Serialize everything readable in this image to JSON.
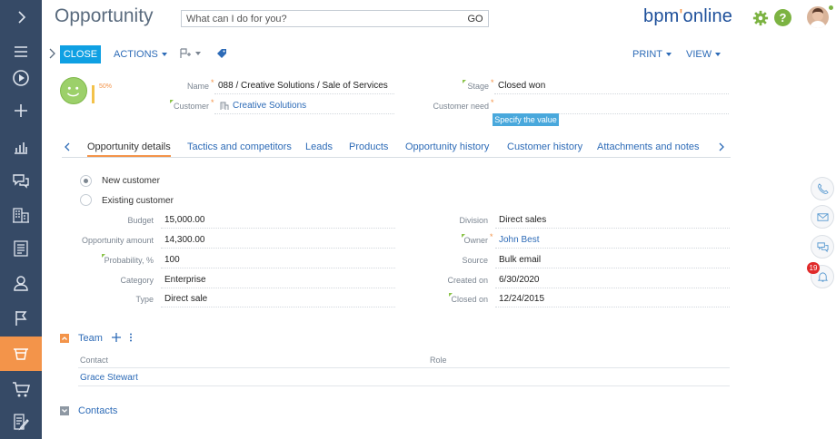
{
  "sidebar": {
    "items": [
      {
        "name": "expand",
        "icon": "chevron-right-icon"
      },
      {
        "name": "menu",
        "icon": "hamburger-icon"
      },
      {
        "name": "play",
        "icon": "play-circle-icon"
      },
      {
        "name": "add",
        "icon": "plus-icon"
      },
      {
        "name": "dashboards",
        "icon": "bar-chart-icon"
      },
      {
        "name": "feed",
        "icon": "chat-bubbles-icon"
      },
      {
        "name": "accounts",
        "icon": "buildings-icon"
      },
      {
        "name": "documents",
        "icon": "document-icon"
      },
      {
        "name": "contacts",
        "icon": "person-icon"
      },
      {
        "name": "flags",
        "icon": "flag-icon"
      },
      {
        "name": "opportunities",
        "icon": "funnel-icon",
        "active": true
      },
      {
        "name": "orders",
        "icon": "cart-icon"
      },
      {
        "name": "notes",
        "icon": "edit-icon"
      }
    ]
  },
  "header": {
    "title": "Opportunity",
    "search_placeholder": "What can I do for you?",
    "go_label": "GO",
    "logo_main": "bpm",
    "logo_tail": "online"
  },
  "toolbar": {
    "close_label": "CLOSE",
    "actions_label": "ACTIONS",
    "print_label": "PRINT",
    "view_label": "VIEW"
  },
  "summary": {
    "probability_text": "50%",
    "fields": {
      "name_label": "Name",
      "name_value": "088 / Creative Solutions / Sale of Services",
      "customer_label": "Customer",
      "customer_value": "Creative Solutions",
      "stage_label": "Stage",
      "stage_value": "Closed won",
      "customer_need_label": "Customer need",
      "specify_label": "Specify the value"
    }
  },
  "tabs": [
    {
      "label": "Opportunity details",
      "active": true
    },
    {
      "label": "Tactics and competitors"
    },
    {
      "label": "Leads"
    },
    {
      "label": "Products"
    },
    {
      "label": "Opportunity history"
    },
    {
      "label": "Customer history"
    },
    {
      "label": "Attachments and notes"
    }
  ],
  "details": {
    "radio_new": "New customer",
    "radio_existing": "Existing customer",
    "left": [
      {
        "label": "Budget",
        "value": "15,000.00"
      },
      {
        "label": "Opportunity amount",
        "value": "14,300.00"
      },
      {
        "label": "Probability, %",
        "value": "100"
      },
      {
        "label": "Category",
        "value": "Enterprise"
      },
      {
        "label": "Type",
        "value": "Direct sale"
      }
    ],
    "right": [
      {
        "label": "Division",
        "value": "Direct sales"
      },
      {
        "label": "Owner",
        "value": "John Best"
      },
      {
        "label": "Source",
        "value": "Bulk email"
      },
      {
        "label": "Created on",
        "value": "6/30/2020"
      },
      {
        "label": "Closed on",
        "value": "12/24/2015"
      }
    ]
  },
  "team": {
    "title": "Team",
    "col_contact": "Contact",
    "col_role": "Role",
    "rows": [
      {
        "contact": "Grace Stewart",
        "role": ""
      }
    ]
  },
  "contacts_section": {
    "title": "Contacts"
  },
  "right_panel": {
    "notification_count": "19"
  },
  "colors": {
    "sidebar": "#364a66",
    "active": "#f3944a",
    "accent": "#0fa0e3",
    "link": "#2d6bb7"
  }
}
